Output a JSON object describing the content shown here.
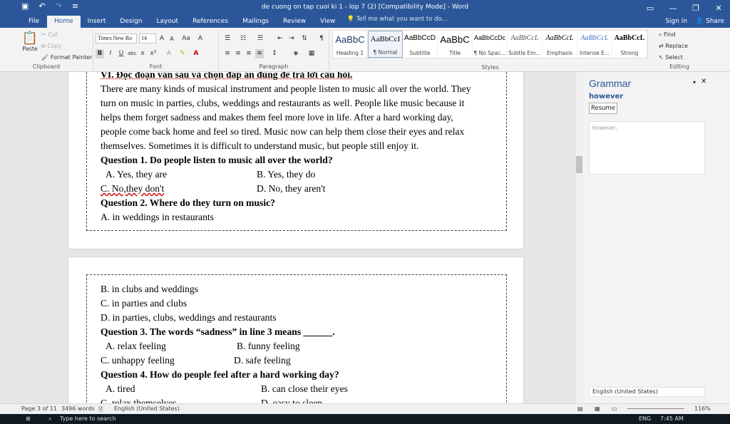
{
  "window": {
    "title": "de cuong on tap cuoi ki 1 - lop 7 (2) [Compatibility Mode] - Word",
    "icons": [
      "save-icon",
      "undo-icon",
      "redo-icon",
      "customize-icon",
      "ribbon-display-icon",
      "minimize-icon",
      "restore-icon",
      "close-icon"
    ]
  },
  "tabs": [
    "File",
    "Home",
    "Insert",
    "Design",
    "Layout",
    "References",
    "Mailings",
    "Review",
    "View"
  ],
  "tell_me": "Tell me what you want to do...",
  "sign_in": "Sign in",
  "share": "Share",
  "clipboard": {
    "paste": "Paste",
    "cut": "Cut",
    "copy": "Copy",
    "format_painter": "Format Painter",
    "label": "Clipboard"
  },
  "font": {
    "name": "Times New Ro",
    "size": "14",
    "label": "Font"
  },
  "paragraph": {
    "label": "Paragraph"
  },
  "styles": {
    "label": "Styles",
    "items": [
      {
        "preview": "AaBbC",
        "name": "Heading 1"
      },
      {
        "preview": "AaBbCcI",
        "name": "¶ Normal"
      },
      {
        "preview": "AaBbCcD",
        "name": "Subtitle"
      },
      {
        "preview": "AaBbC",
        "name": "Title"
      },
      {
        "preview": "AaBbCcDc",
        "name": "¶ No Spac..."
      },
      {
        "preview": "AaBbCcL",
        "name": "Subtle Em..."
      },
      {
        "preview": "AaBbCcL",
        "name": "Emphasis"
      },
      {
        "preview": "AaBbCcL",
        "name": "Intense E..."
      },
      {
        "preview": "AaBbCcL",
        "name": "Strong"
      }
    ]
  },
  "editing": {
    "find": "Find",
    "replace": "Replace",
    "select": "Select",
    "label": "Editing"
  },
  "page1": [
    "VI. Đọc đoạn văn sau và chọn đáp án đúng để trả lời câu hỏi.",
    "There are many kinds of musical instrument and people listen to music all over the world. They",
    "turn on music in parties, clubs, weddings and restaurants as well. People like music because it",
    "helps them forget sadness and makes them feel more love in life. After a hard working day,",
    "people come back home and feel so tired. Music now can help them close their eyes and relax",
    "themselves. Sometimes it is difficult to understand music, but people still enjoy it.",
    "Question 1.  Do people listen to music all over the world?",
    "A. Yes, they are",
    "B.  Yes, they do",
    "C. No,they don't",
    "D.   No, they aren't",
    "Question 2.   Where do they turn on music?",
    "A. in weddings in restaurants"
  ],
  "page2": [
    "B. in clubs and weddings",
    "C.  in parties and clubs",
    "D.   in parties, clubs, weddings and restaurants",
    "Question 3.   The words “sadness” in line 3 means ______.",
    "A. relax feeling",
    "B.  funny feeling",
    "C. unhappy feeling",
    "D.   safe feeling",
    "Question 4.   How do people feel after a hard working day?",
    "A. tired",
    "B. can close their eyes",
    "C. relax themselves",
    "D. easy to sleep"
  ],
  "grammar": {
    "title": "Grammar",
    "word": "however",
    "resume": "Resume",
    "context": "however,",
    "language": "English (United States)"
  },
  "status": {
    "page": "Page 3 of 11",
    "words": "3496 words",
    "language": "English (United States)",
    "zoom": "116%"
  },
  "taskbar": {
    "search": "Type here to search",
    "time": "7:45 AM",
    "lang": "ENG"
  }
}
